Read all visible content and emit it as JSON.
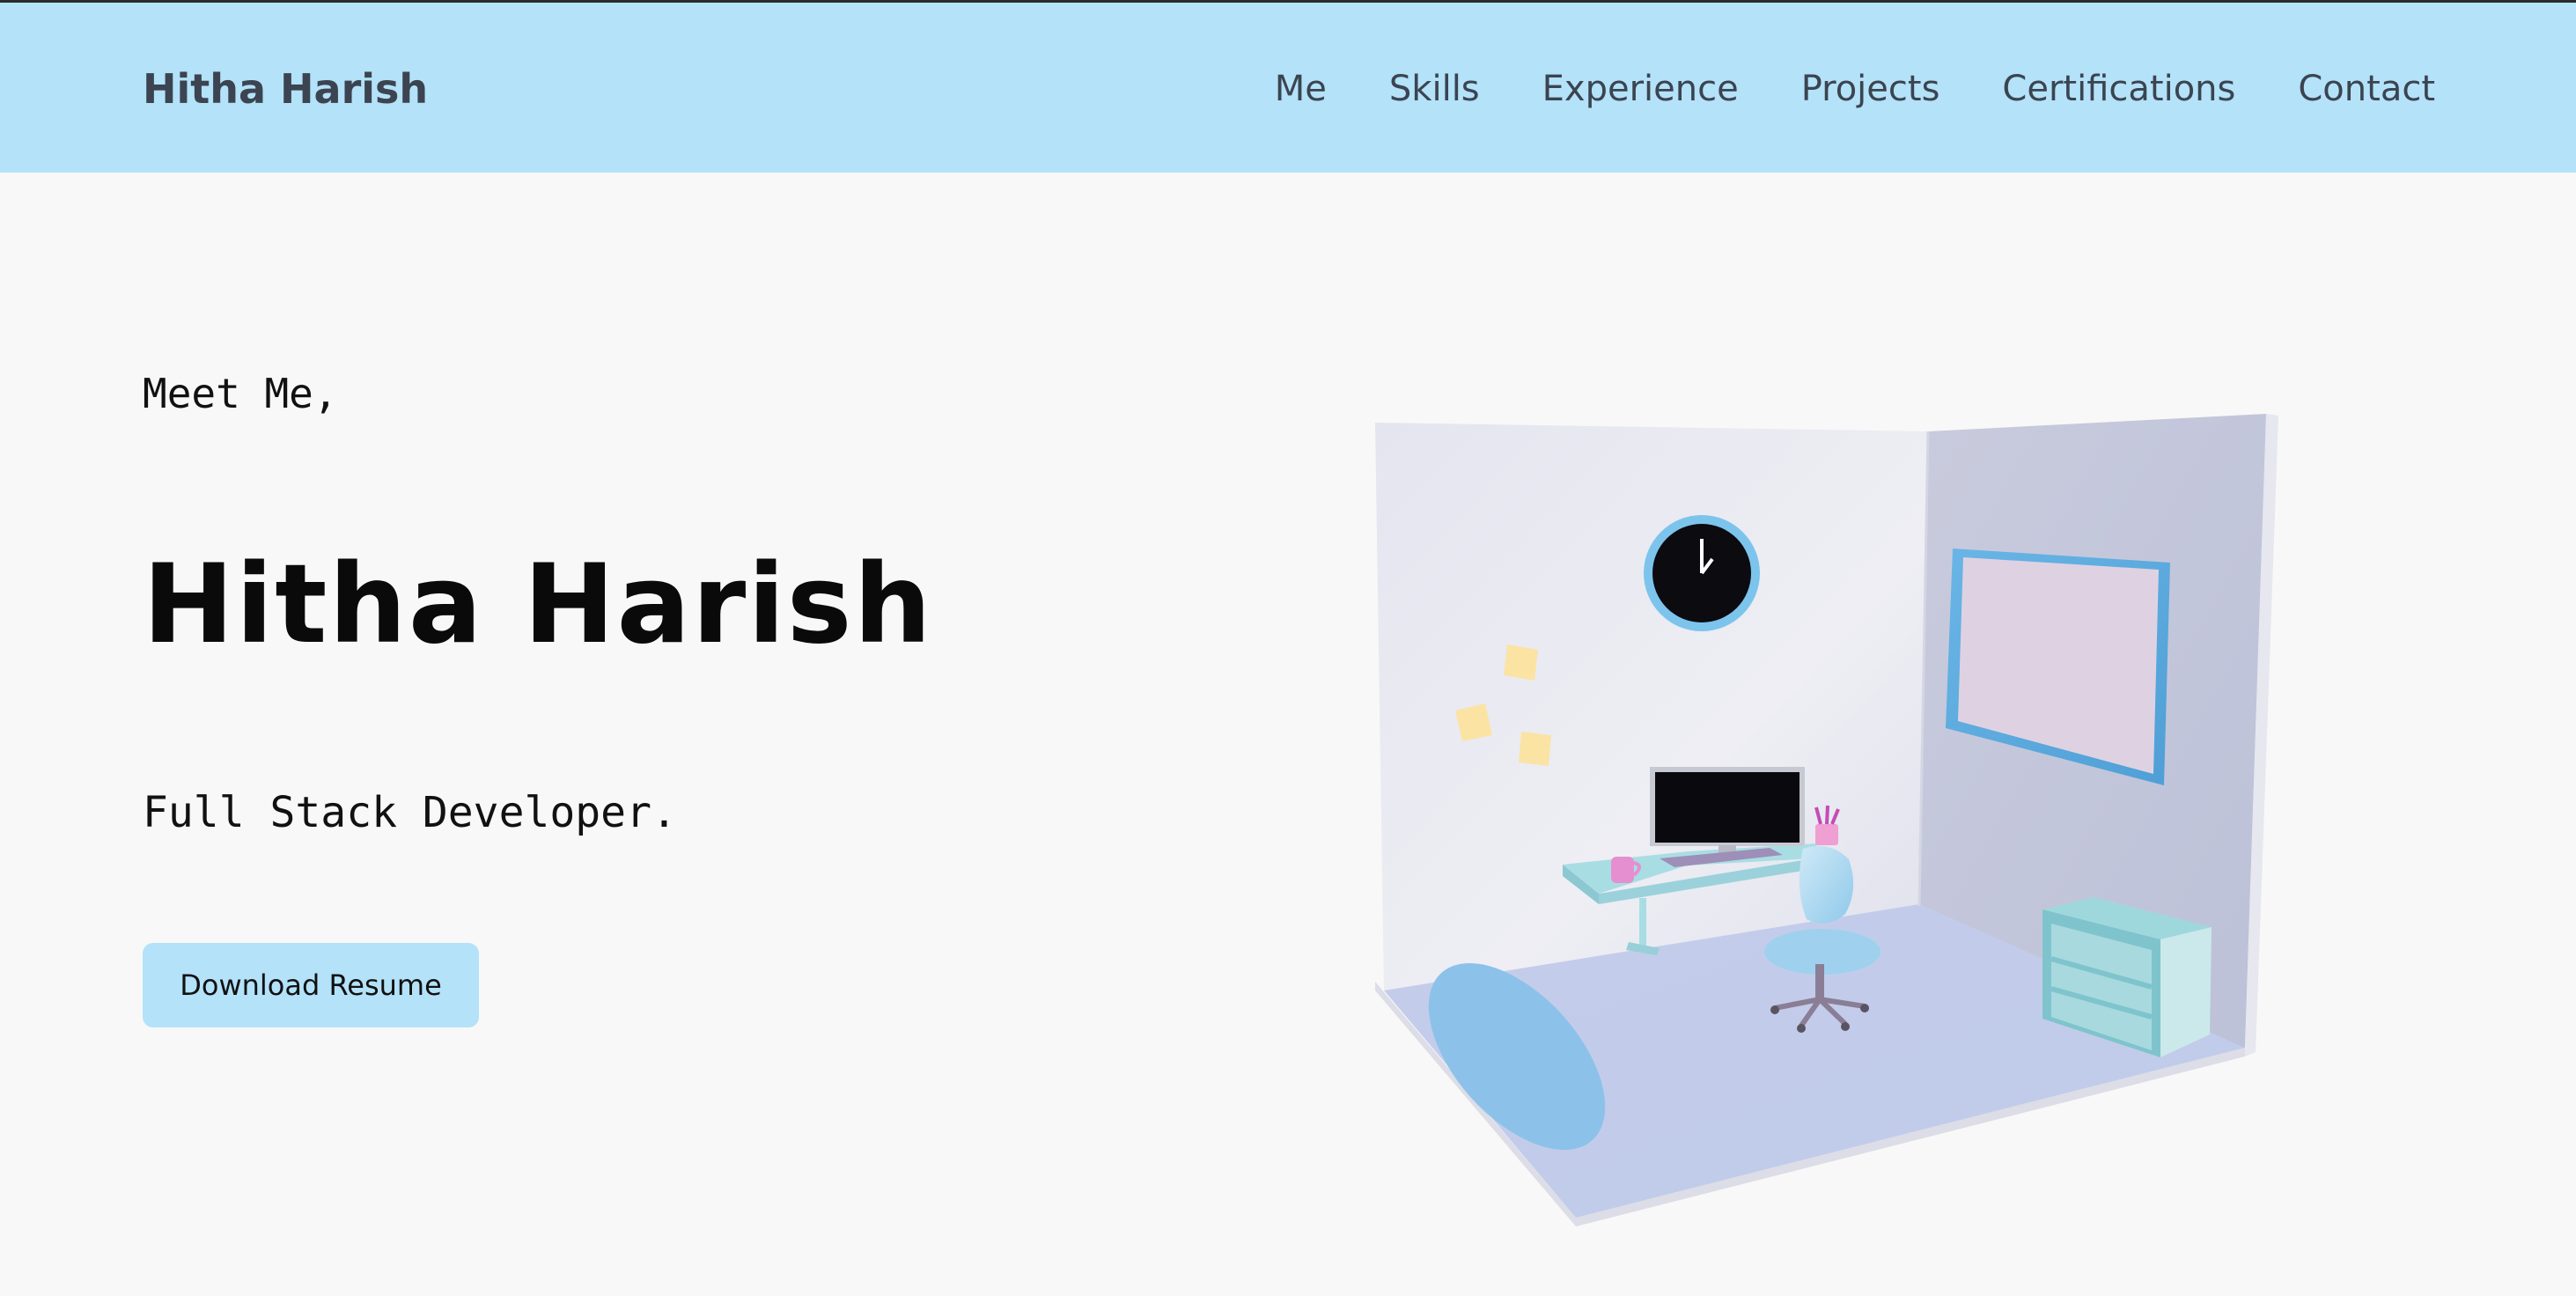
{
  "header": {
    "brand": "Hitha Harish",
    "nav": [
      "Me",
      "Skills",
      "Experience",
      "Projects",
      "Certifications",
      "Contact"
    ]
  },
  "hero": {
    "greeting": "Meet Me,",
    "name": "Hitha Harish",
    "role": "Full Stack Developer.",
    "button_label": "Download Resume"
  },
  "illustration": {
    "icon": "room-illustration-icon"
  },
  "colors": {
    "nav_background": "#b3e2f9",
    "page_background": "#f8f8f8",
    "button_background": "#b3e2f9",
    "nav_text": "#3b4450"
  }
}
